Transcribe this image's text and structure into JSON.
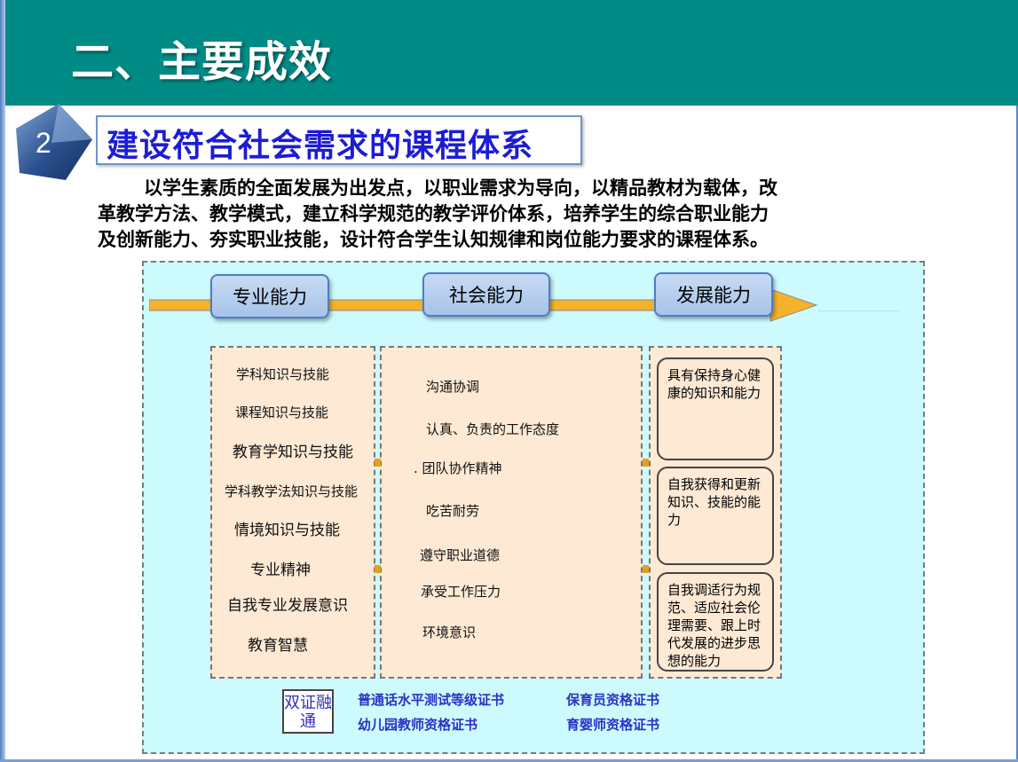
{
  "header": {
    "title": "二、主要成效",
    "bg_color": "#008b86"
  },
  "section": {
    "number": "2",
    "title": "建设符合社会需求的课程体系"
  },
  "intro_lines": [
    "以学生素质的全面发展为出发点，以职业需求为导向，以精品教材为载体，改",
    "革教学方法、教学模式，建立科学规范的教学评价体系，培养学生的综合职业能力",
    "及创新能力、夯实职业技能，设计符合学生认知规律和岗位能力要求的课程体系。"
  ],
  "diagram": {
    "capabilities": [
      "专业能力",
      "社会能力",
      "发展能力"
    ],
    "professional_items": [
      "学科知识与技能",
      "课程知识与技能",
      "教育学知识与技能",
      "学科教学法知识与技能",
      "情境知识与技能",
      "专业精神",
      "自我专业发展意识",
      "教育智慧"
    ],
    "social_items": [
      "沟通协调",
      "认真、负责的工作态度",
      ". 团队协作精神",
      "吃苦耐劳",
      "遵守职业道德",
      "承受工作压力",
      "环境意识"
    ],
    "development_items": [
      "具有保持身心健康的知识和能力",
      "自我获得和更新知识、技能的能力",
      "自我调适行为规范、适应社会伦理需要、跟上时代发展的进步思想的能力"
    ],
    "certificate_label": "双证融通",
    "certificates": [
      "普通话水平测试等级证书",
      "保育员资格证书",
      "幼儿园教师资格证书",
      "育婴师资格证书"
    ]
  }
}
